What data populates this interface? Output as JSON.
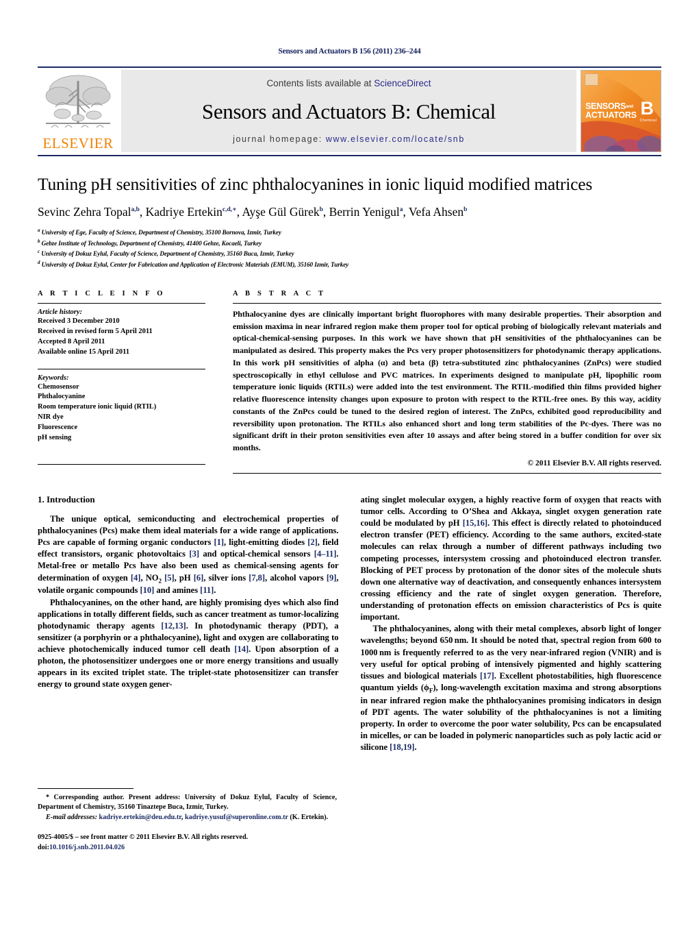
{
  "running_head": "Sensors and Actuators B 156 (2011) 236–244",
  "masthead": {
    "publisher": "ELSEVIER",
    "contents_prefix": "Contents lists available at ",
    "contents_link": "ScienceDirect",
    "journal_title": "Sensors and Actuators B: Chemical",
    "homepage_prefix": "journal homepage: ",
    "homepage_url": "www.elsevier.com/locate/snb",
    "cover": {
      "line1": "SENSORS",
      "and": "and",
      "line2": "ACTUATORS",
      "series": "B",
      "sub": "Chemical"
    },
    "accent_navy": "#1b2a63",
    "accent_orange": "#ef8200",
    "band_gray": "#e9e9e9"
  },
  "title": "Tuning pH sensitivities of zinc phthalocyanines in ionic liquid modified matrices",
  "authors": [
    {
      "name": "Sevinc Zehra Topal",
      "sup": "a,b"
    },
    {
      "name": "Kadriye Ertekin",
      "sup": "c,d,"
    },
    {
      "name": "Ayşe Gül Gürek",
      "sup": "b"
    },
    {
      "name": "Berrin Yenigul",
      "sup": "a"
    },
    {
      "name": "Vefa Ahsen",
      "sup": "b"
    }
  ],
  "affiliations": [
    {
      "mark": "a",
      "text": "University of Ege, Faculty of Science, Department of Chemistry, 35100 Bornova, Izmir, Turkey"
    },
    {
      "mark": "b",
      "text": "Gebze Institute of Technology, Department of Chemistry, 41400 Gebze, Kocaeli, Turkey"
    },
    {
      "mark": "c",
      "text": "University of Dokuz Eylul, Faculty of Science, Department of Chemistry, 35160 Buca, Izmir, Turkey"
    },
    {
      "mark": "d",
      "text": "University of Dokuz Eylul, Center for Fabrication and Application of Electronic Materials (EMUM), 35160 Izmir, Turkey"
    }
  ],
  "article_info": {
    "label": "A R T I C L E  I N F O",
    "history_head": "Article history:",
    "history": [
      "Received 3 December 2010",
      "Received in revised form 5 April 2011",
      "Accepted 8 April 2011",
      "Available online 15 April 2011"
    ],
    "keywords_head": "Keywords:",
    "keywords": [
      "Chemosensor",
      "Phthalocyanine",
      "Room temperature ionic liquid (RTIL)",
      "NIR dye",
      "Fluorescence",
      "pH sensing"
    ]
  },
  "abstract": {
    "label": "A B S T R A C T",
    "text": "Phthalocyanine dyes are clinically important bright fluorophores with many desirable properties. Their absorption and emission maxima in near infrared region make them proper tool for optical probing of biologically relevant materials and optical-chemical-sensing purposes. In this work we have shown that pH sensitivities of the phthalocyanines can be manipulated as desired. This property makes the Pcs very proper photosensitizers for photodynamic therapy applications. In this work pH sensitivities of alpha (α) and beta (β) tetra-substituted zinc phthalocyanines (ZnPcs) were studied spectroscopically in ethyl cellulose and PVC matrices. In experiments designed to manipulate pH, lipophilic room temperature ionic liquids (RTILs) were added into the test environment. The RTIL-modified thin films provided higher relative fluorescence intensity changes upon exposure to proton with respect to the RTIL-free ones. By this way, acidity constants of the ZnPcs could be tuned to the desired region of interest. The ZnPcs, exhibited good reproducibility and reversibility upon protonation. The RTILs also enhanced short and long term stabilities of the Pc-dyes. There was no significant drift in their proton sensitivities even after 10 assays and after being stored in a buffer condition for over six months.",
    "copyright": "© 2011 Elsevier B.V. All rights reserved."
  },
  "body": {
    "section_number_title": "1.  Introduction",
    "left_paragraphs": [
      "The unique optical, semiconducting and electrochemical properties of phthalocyanines (Pcs) make them ideal materials for a wide range of applications. Pcs are capable of forming organic conductors [1], light-emitting diodes [2], field effect transistors, organic photovoltaics [3] and optical-chemical sensors [4–11]. Metal-free or metallo Pcs have also been used as chemical-sensing agents for determination of oxygen [4], NO2 [5], pH [6], silver ions [7,8], alcohol vapors [9], volatile organic compounds [10] and amines [11].",
      "Phthalocyanines, on the other hand, are highly promising dyes which also find applications in totally different fields, such as cancer treatment as tumor-localizing photodynamic therapy agents [12,13]. In photodynamic therapy (PDT), a sensitizer (a porphyrin or a phthalocyanine), light and oxygen are collaborating to achieve photochemically induced tumor cell death [14]. Upon absorption of a photon, the photosensitizer undergoes one or more energy transitions and usually appears in its excited triplet state. The triplet-state photosensitizer can transfer energy to ground state oxygen gener-"
    ],
    "right_paragraphs": [
      "ating singlet molecular oxygen, a highly reactive form of oxygen that reacts with tumor cells. According to O'Shea and Akkaya, singlet oxygen generation rate could be modulated by pH [15,16]. This effect is directly related to photoinduced electron transfer (PET) efficiency. According to the same authors, excited-state molecules can relax through a number of different pathways including two competing processes, intersystem crossing and photoinduced electron transfer. Blocking of PET process by protonation of the donor sites of the molecule shuts down one alternative way of deactivation, and consequently enhances intersystem crossing efficiency and the rate of singlet oxygen generation. Therefore, understanding of protonation effects on emission characteristics of Pcs is quite important.",
      "The phthalocyanines, along with their metal complexes, absorb light of longer wavelengths; beyond 650 nm. It should be noted that, spectral region from 600 to 1000 nm is frequently referred to as the very near-infrared region (VNIR) and is very useful for optical probing of intensively pigmented and highly scattering tissues and biological materials [17]. Excellent photostabilities, high fluorescence quantum yields (ϕF), long-wavelength excitation maxima and strong absorptions in near infrared region make the phthalocyanines promising indicators in design of PDT agents. The water solubility of the phthalocyanines is not a limiting property. In order to overcome the poor water solubility, Pcs can be encapsulated in micelles, or can be loaded in polymeric nanoparticles such as poly lactic acid or silicone [18,19]."
    ]
  },
  "footnote": {
    "corresponding": "* Corresponding author. Present address: University of Dokuz Eylul, Faculty of Science, Department of Chemistry, 35160 Tinaztepe Buca, Izmir, Turkey.",
    "email_label": "E-mail addresses:",
    "email1": "kadriye.ertekin@deu.edu.tr",
    "email2": "kadriye.yusuf@superonline.com.tr",
    "email_owner": "(K. Ertekin).",
    "issn_line": "0925-4005/$ – see front matter © 2011 Elsevier B.V. All rights reserved.",
    "doi_label": "doi:",
    "doi_value": "10.1016/j.snb.2011.04.026"
  }
}
